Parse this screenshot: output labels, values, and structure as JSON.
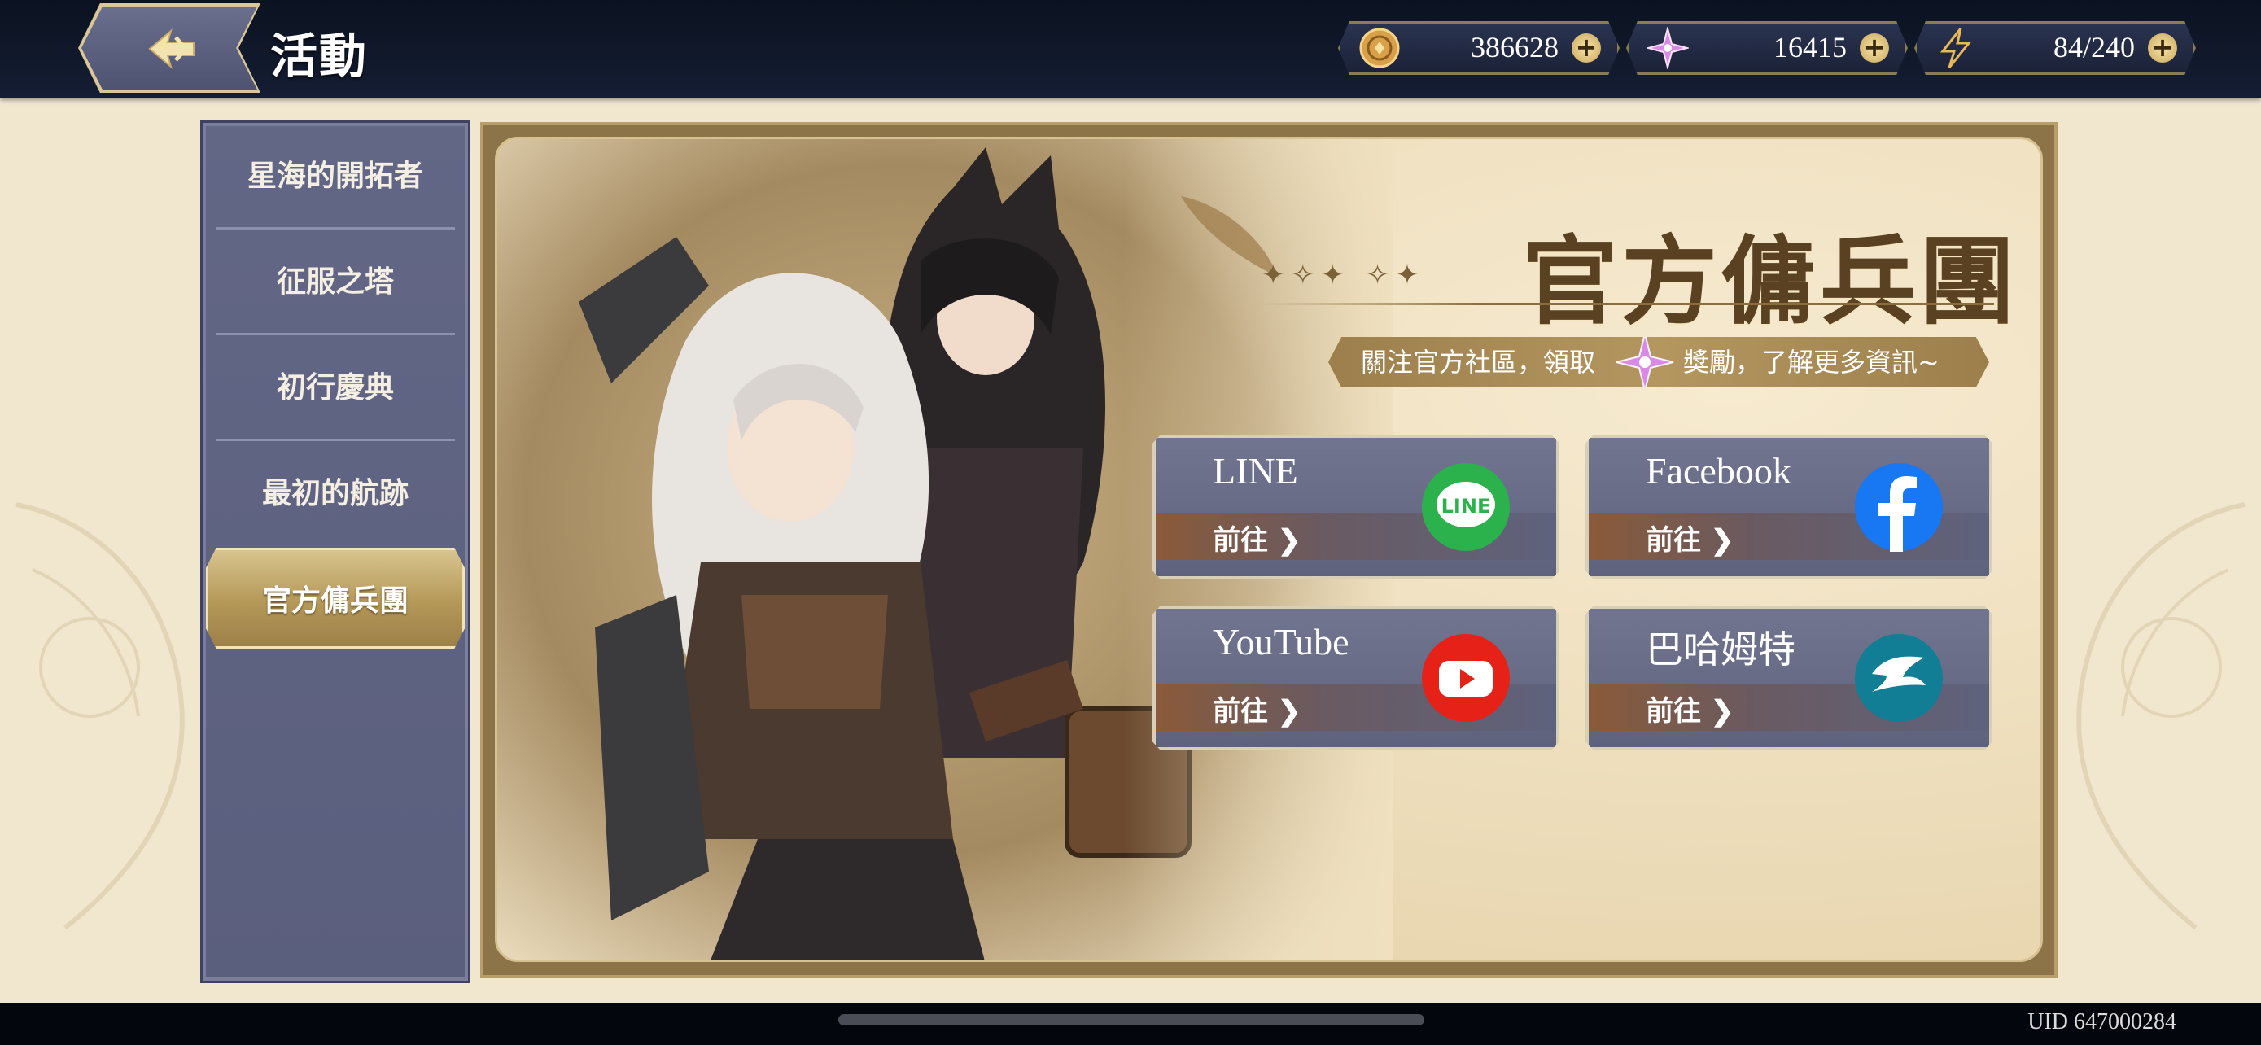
{
  "header": {
    "title": "活動",
    "back_label": ""
  },
  "currencies": [
    {
      "name": "gold",
      "value": "386628",
      "icon": "gold-coin-icon"
    },
    {
      "name": "crystal",
      "value": "16415",
      "icon": "purple-crystal-icon"
    },
    {
      "name": "stamina",
      "value": "84/240",
      "icon": "lightning-icon"
    }
  ],
  "sidebar": {
    "items": [
      {
        "label": "星海的開拓者",
        "active": false
      },
      {
        "label": "征服之塔",
        "active": false
      },
      {
        "label": "初行慶典",
        "active": false
      },
      {
        "label": "最初的航跡",
        "active": false
      },
      {
        "label": "官方傭兵團",
        "active": true
      }
    ]
  },
  "event": {
    "title": "官方傭兵團",
    "stars": "✦✧✦ ✧✦",
    "info_part1": "關注官方社區，領取",
    "info_part2": "獎勵，了解更多資訊~",
    "links": [
      {
        "name": "LINE",
        "goto": "前往 ❯",
        "icon": "line-icon",
        "color": "#2bb24c"
      },
      {
        "name": "Facebook",
        "goto": "前往 ❯",
        "icon": "facebook-icon",
        "color": "#1877f2"
      },
      {
        "name": "YouTube",
        "goto": "前往 ❯",
        "icon": "youtube-icon",
        "color": "#e62117"
      },
      {
        "name": "巴哈姆特",
        "goto": "前往 ❯",
        "icon": "bahamut-icon",
        "color": "#117e96"
      }
    ]
  },
  "footer": {
    "uid": "UID 647000284"
  },
  "colors": {
    "topbar": "#0b1220",
    "sidebar": "#636786",
    "active_tab": "#b49858",
    "panel_bg": "#efe0bf",
    "title_text": "#5a4122"
  }
}
